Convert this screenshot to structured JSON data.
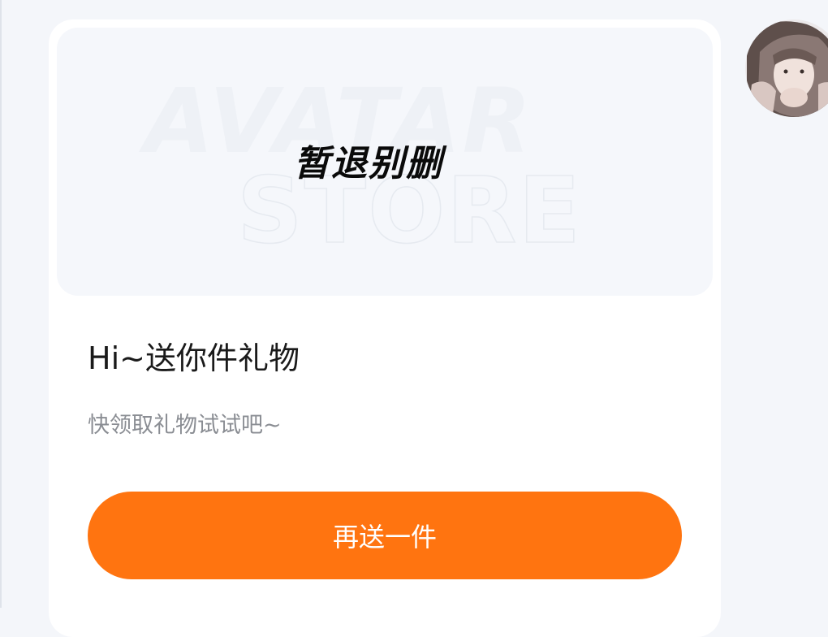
{
  "banner": {
    "watermark_line1": "AVATAR",
    "watermark_line2": "STORE",
    "title": "暂退别删"
  },
  "card": {
    "headline": "Hi~送你件礼物",
    "subtitle": "快领取礼物试试吧~",
    "button_label": "再送一件"
  },
  "colors": {
    "accent": "#ff7410",
    "page_background": "#f4f6fa",
    "card_background": "#ffffff",
    "banner_background": "#f5f7fb"
  }
}
